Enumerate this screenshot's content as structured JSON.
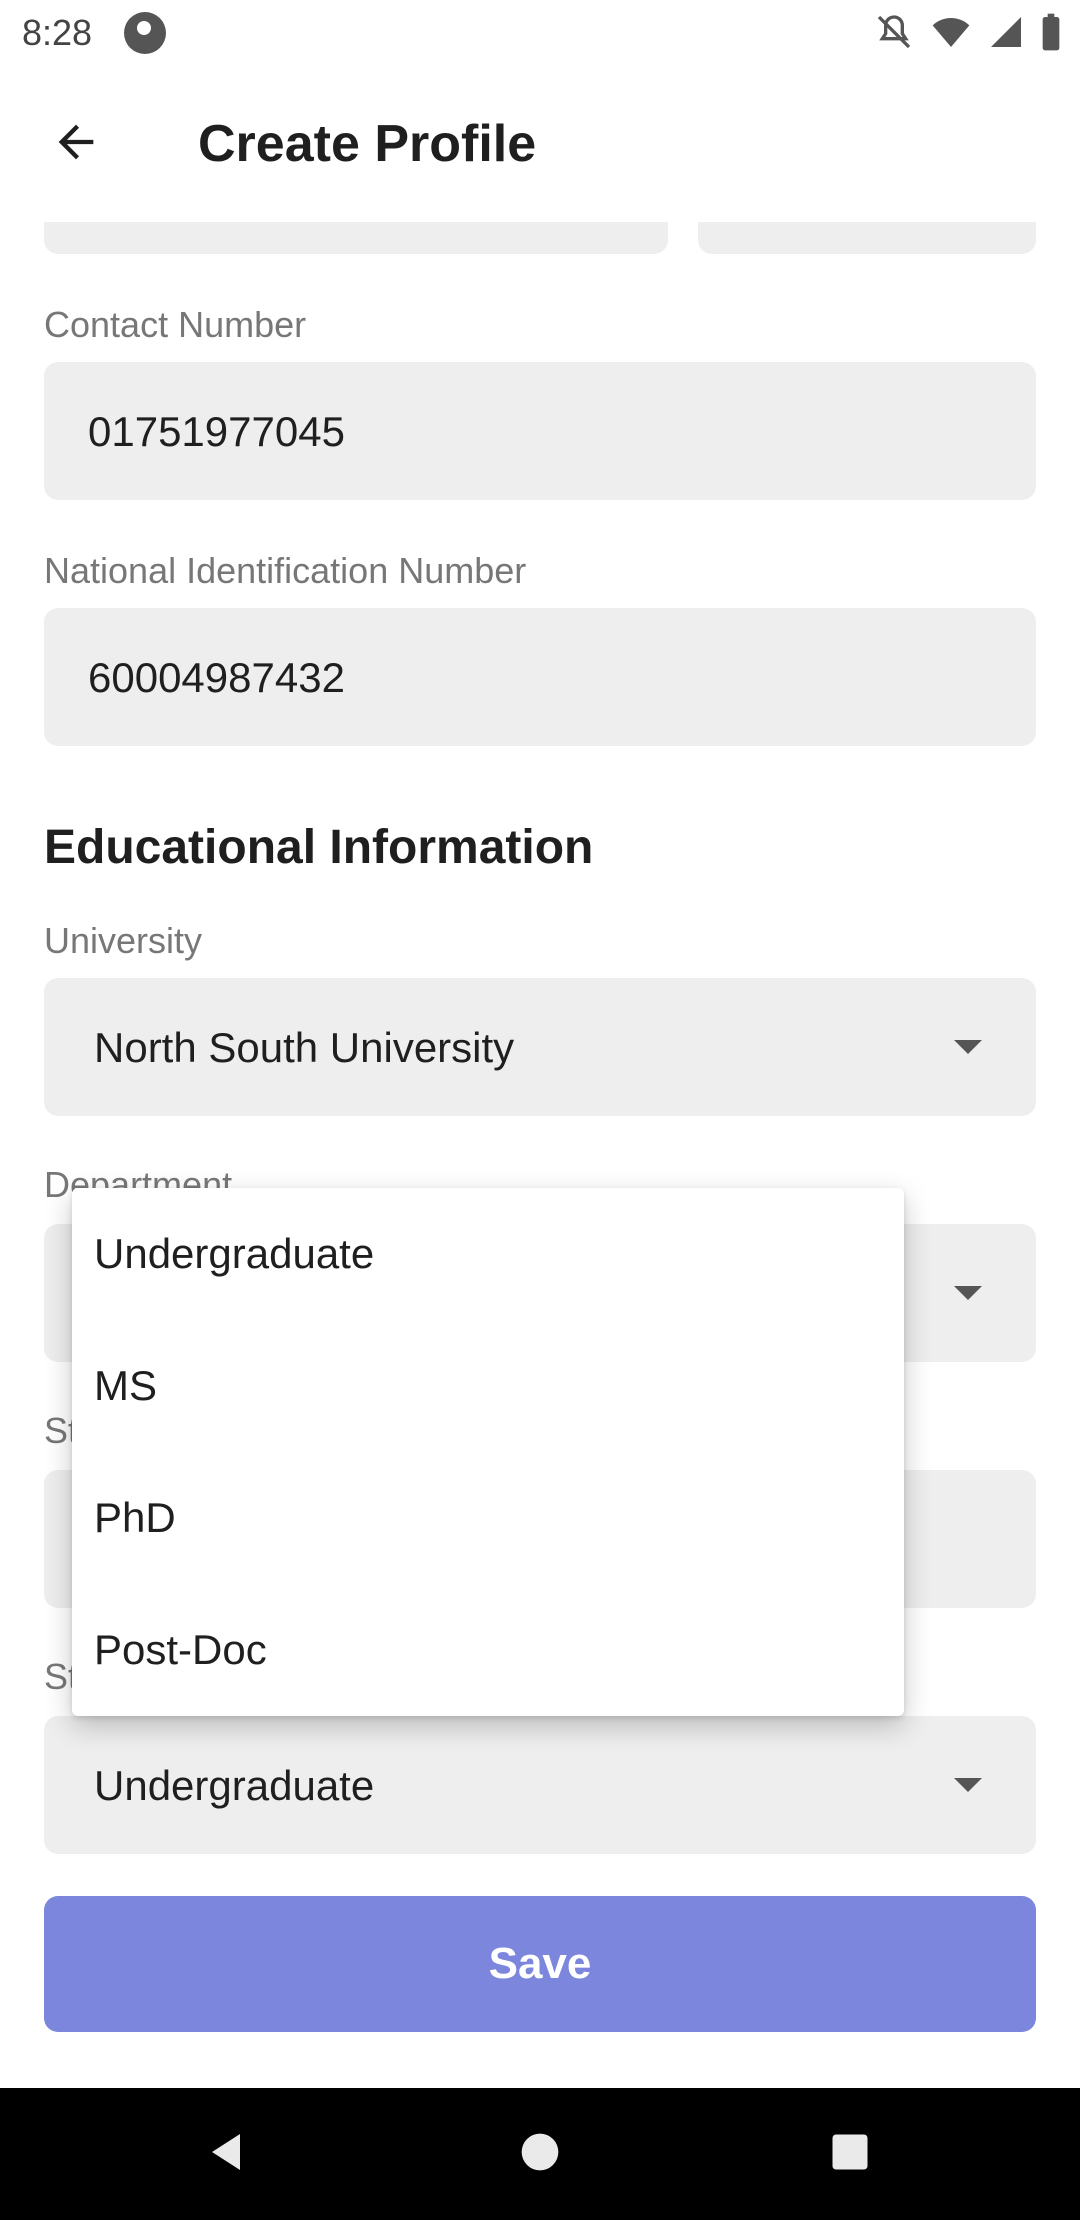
{
  "status_bar": {
    "time": "8:28"
  },
  "app_bar": {
    "title": "Create Profile"
  },
  "form": {
    "contact_number": {
      "label": "Contact Number",
      "value": "01751977045"
    },
    "national_id": {
      "label": "National Identification Number",
      "value": "60004987432"
    },
    "educational_section_title": "Educational Information",
    "university": {
      "label": "University",
      "value": "North South University"
    },
    "department": {
      "label": "Department"
    },
    "status_level": {
      "value": "Undergraduate"
    }
  },
  "dropdown_menu": {
    "items": [
      {
        "label": "Undergraduate"
      },
      {
        "label": "MS"
      },
      {
        "label": "PhD"
      },
      {
        "label": "Post-Doc"
      }
    ]
  },
  "save_button": {
    "label": "Save"
  },
  "colors": {
    "accent": "#7b86dc",
    "field_background": "#eeeeee",
    "label_text": "#777777"
  }
}
